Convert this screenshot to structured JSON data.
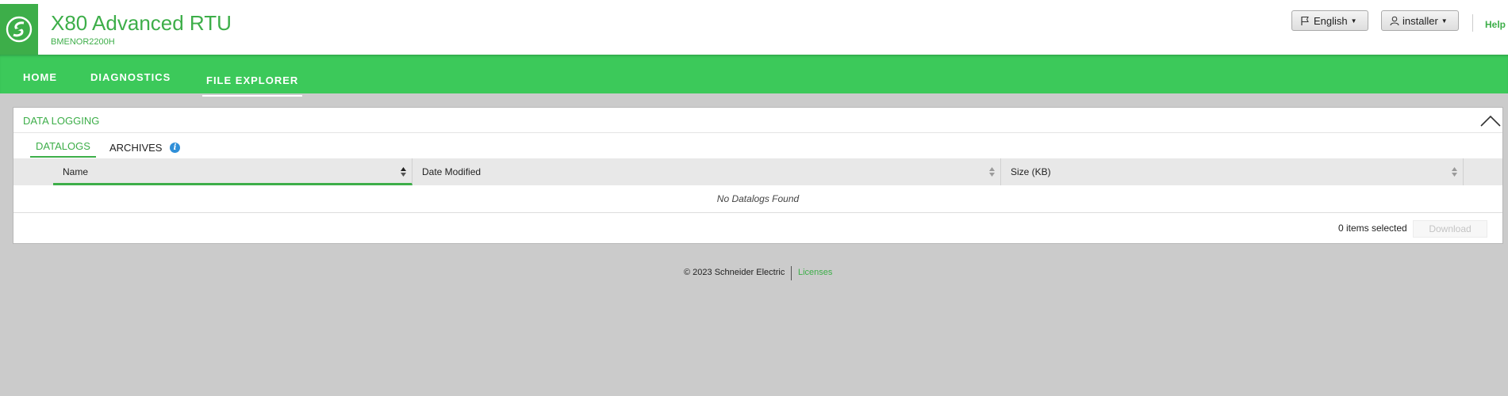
{
  "header": {
    "title": "X80 Advanced RTU",
    "subtitle": "BMENOR2200H",
    "language_button": "English",
    "user_button": "installer",
    "help": "Help"
  },
  "nav": {
    "items": [
      {
        "label": "HOME"
      },
      {
        "label": "DIAGNOSTICS"
      },
      {
        "label": "FILE EXPLORER"
      }
    ],
    "active": "FILE EXPLORER"
  },
  "panel": {
    "title": "DATA LOGGING",
    "tabs": [
      {
        "label": "DATALOGS"
      },
      {
        "label": "ARCHIVES"
      }
    ],
    "columns": [
      "Name",
      "Date Modified",
      "Size (KB)"
    ],
    "empty_message": "No Datalogs Found",
    "selection_text": "0 items selected",
    "download_label": "Download"
  },
  "footer": {
    "copyright": "© 2023 Schneider Electric",
    "licenses": "Licenses"
  },
  "colors": {
    "brand_green": "#3dae49",
    "nav_green": "#3cc95a",
    "background": "#cbcbcb"
  }
}
